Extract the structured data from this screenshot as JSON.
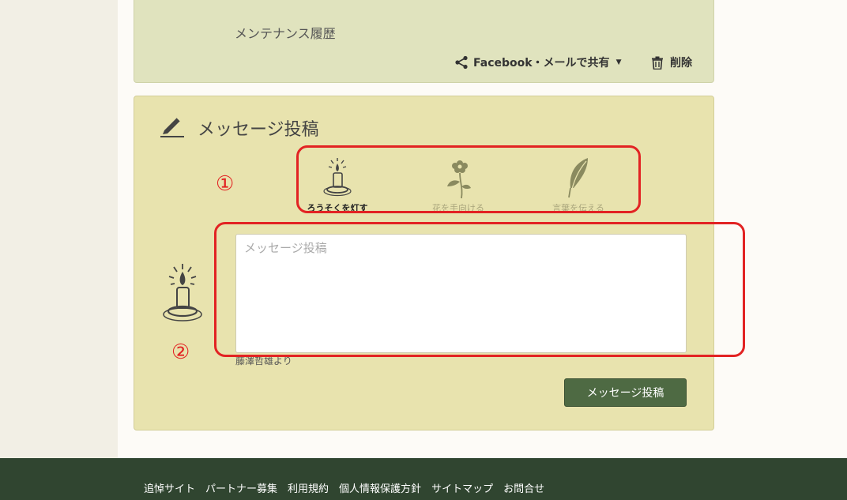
{
  "top_panel": {
    "maintenance_label": "メンテナンス履歴",
    "share_label": "Facebook・メールで共有",
    "delete_label": "削除"
  },
  "message_panel": {
    "title": "メッセージ投稿",
    "offerings": [
      {
        "label": "ろうそくを灯す",
        "icon": "candle-icon",
        "selected": true
      },
      {
        "label": "花を手向ける",
        "icon": "flower-icon",
        "selected": false
      },
      {
        "label": "言葉を伝える",
        "icon": "feather-icon",
        "selected": false
      }
    ],
    "textarea_placeholder": "メッセージ投稿",
    "from_label": "藤澤哲雄より",
    "submit_label": "メッセージ投稿"
  },
  "annotations": {
    "num1": "①",
    "num2": "②",
    "color": "#e22323"
  },
  "colors": {
    "panel_top_bg": "#e0e3be",
    "panel_msg_bg": "#e8e3ae",
    "button_bg": "#4e6a43",
    "footer_bg": "#304530"
  },
  "footer": {
    "links": [
      "追悼サイト",
      "パートナー募集",
      "利用規約",
      "個人情報保護方針",
      "サイトマップ",
      "お問合せ"
    ]
  }
}
